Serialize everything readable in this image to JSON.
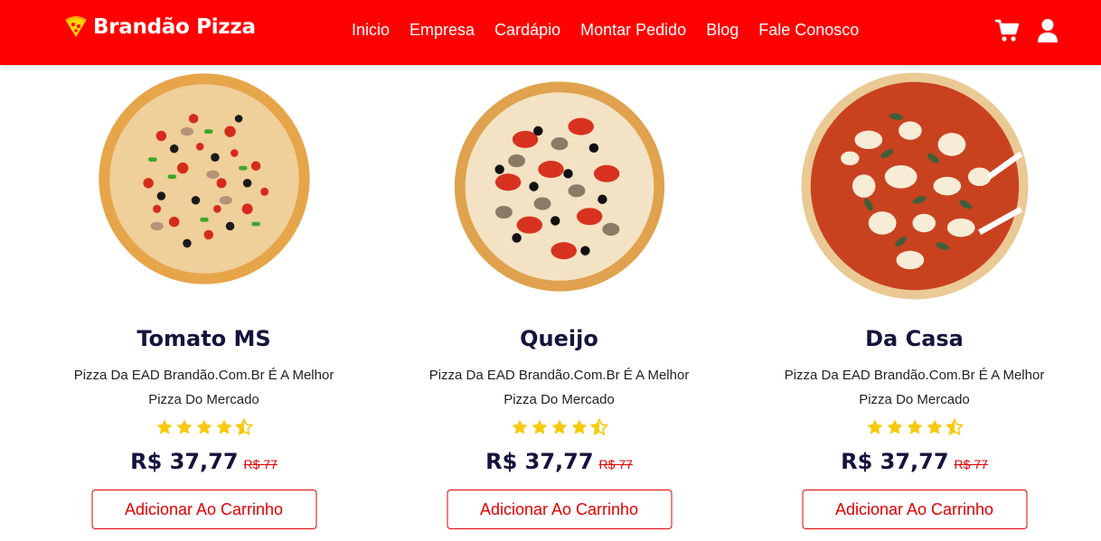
{
  "header": {
    "brand": "Brandão Pizza",
    "nav": [
      "Inicio",
      "Empresa",
      "Cardápio",
      "Montar Pedido",
      "Blog",
      "Fale Conosco"
    ],
    "icons": [
      "pizza-logo-icon",
      "cart-icon",
      "user-icon"
    ],
    "bg_color": "#ff0000"
  },
  "products": [
    {
      "name": "Tomato MS",
      "desc_line1": "Pizza Da EAD Brandão.Com.Br É A Melhor",
      "desc_line2": "Pizza Do Mercado",
      "rating": 4.5,
      "price": "R$ 37,77",
      "old_price": "R$ 77",
      "button": "Adicionar Ao Carrinho"
    },
    {
      "name": "Queijo",
      "desc_line1": "Pizza Da EAD Brandão.Com.Br É A Melhor",
      "desc_line2": "Pizza Do Mercado",
      "rating": 4.5,
      "price": "R$ 37,77",
      "old_price": "R$ 77",
      "button": "Adicionar Ao Carrinho"
    },
    {
      "name": "Da Casa",
      "desc_line1": "Pizza Da EAD Brandão.Com.Br É A Melhor",
      "desc_line2": "Pizza Do Mercado",
      "rating": 4.5,
      "price": "R$ 37,77",
      "old_price": "R$ 77",
      "button": "Adicionar Ao Carrinho"
    }
  ],
  "colors": {
    "accent": "#e00000",
    "title": "#14143c",
    "star": "#f7c90d"
  }
}
